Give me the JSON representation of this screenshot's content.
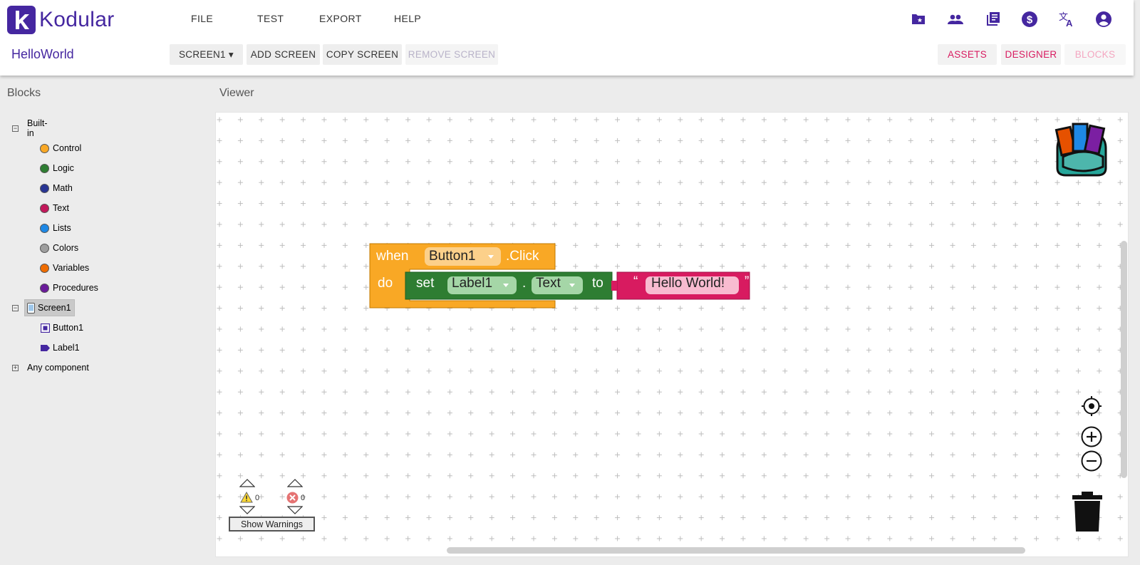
{
  "app": {
    "name": "Kodular",
    "logo_letter": "k"
  },
  "menu": {
    "file": "FILE",
    "test": "TEST",
    "export": "EXPORT",
    "help": "HELP"
  },
  "top_icons": [
    "folder-star-icon",
    "people-icon",
    "library-icon",
    "dollar-icon",
    "translate-icon",
    "account-icon"
  ],
  "project": {
    "name": "HelloWorld"
  },
  "toolbar": {
    "screen_select": "SCREEN1 ▾",
    "add_screen": "ADD SCREEN",
    "copy_screen": "COPY SCREEN",
    "remove_screen": "REMOVE SCREEN",
    "assets": "ASSETS",
    "designer": "DESIGNER",
    "blocks": "BLOCKS"
  },
  "sidebar": {
    "title": "Blocks",
    "builtin_label": "Built-in",
    "builtin_items": [
      {
        "label": "Control",
        "color": "#f9a825"
      },
      {
        "label": "Logic",
        "color": "#2e7d32"
      },
      {
        "label": "Math",
        "color": "#283593"
      },
      {
        "label": "Text",
        "color": "#c2185b"
      },
      {
        "label": "Lists",
        "color": "#1e88e5"
      },
      {
        "label": "Colors",
        "color": "#9e9e9e"
      },
      {
        "label": "Variables",
        "color": "#ef6c00"
      },
      {
        "label": "Procedures",
        "color": "#6a1b9a"
      }
    ],
    "screen_label": "Screen1",
    "components": [
      {
        "label": "Button1",
        "icon": "button-icon"
      },
      {
        "label": "Label1",
        "icon": "label-icon"
      }
    ],
    "any_component": "Any component"
  },
  "viewer": {
    "title": "Viewer",
    "blocks": {
      "when": "when",
      "event_component": "Button1",
      "event_name": ".Click",
      "do": "do",
      "set": "set",
      "set_component": "Label1",
      "dot": ".",
      "property": "Text",
      "to": "to",
      "open_quote": "“",
      "string_value": "Hello World!",
      "close_quote": "”",
      "colors": {
        "event": "#f9a825",
        "setter": "#2e7d32",
        "text": "#d81b60"
      }
    },
    "warnings_count": "0",
    "errors_count": "0",
    "show_warnings": "Show Warnings"
  }
}
